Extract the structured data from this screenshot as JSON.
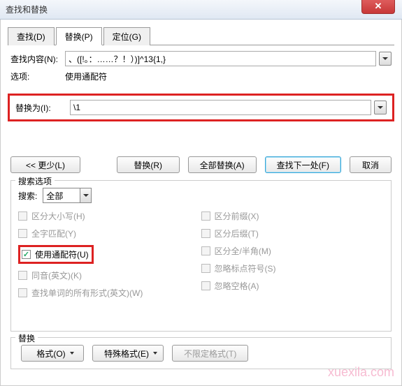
{
  "window": {
    "title": "查找和替换"
  },
  "tabs": {
    "find": "查找(D)",
    "replace": "替换(P)",
    "goto": "定位(G)"
  },
  "labels": {
    "find_what": "查找内容(N):",
    "options": "选项:",
    "replace_with": "替换为(I):",
    "options_value": "使用通配符"
  },
  "values": {
    "find": "、([!。：……？！）)]^13{1,}",
    "replace": "\\1"
  },
  "buttons": {
    "less": "<< 更少(L)",
    "replace": "替换(R)",
    "replace_all": "全部替换(A)",
    "find_next": "查找下一处(F)",
    "cancel": "取消",
    "format": "格式(O)",
    "special": "特殊格式(E)",
    "no_format": "不限定格式(T)"
  },
  "search_options": {
    "legend": "搜索选项",
    "search_label": "搜索:",
    "direction": "全部",
    "match_case": "区分大小写(H)",
    "whole_word": "全字匹配(Y)",
    "wildcards": "使用通配符(U)",
    "sounds_like": "同音(英文)(K)",
    "word_forms": "查找单词的所有形式(英文)(W)",
    "match_prefix": "区分前缀(X)",
    "match_suffix": "区分后缀(T)",
    "full_half": "区分全/半角(M)",
    "ignore_punct": "忽略标点符号(S)",
    "ignore_space": "忽略空格(A)"
  },
  "replace_section": {
    "legend": "替换"
  },
  "watermark": "xuexila.com"
}
